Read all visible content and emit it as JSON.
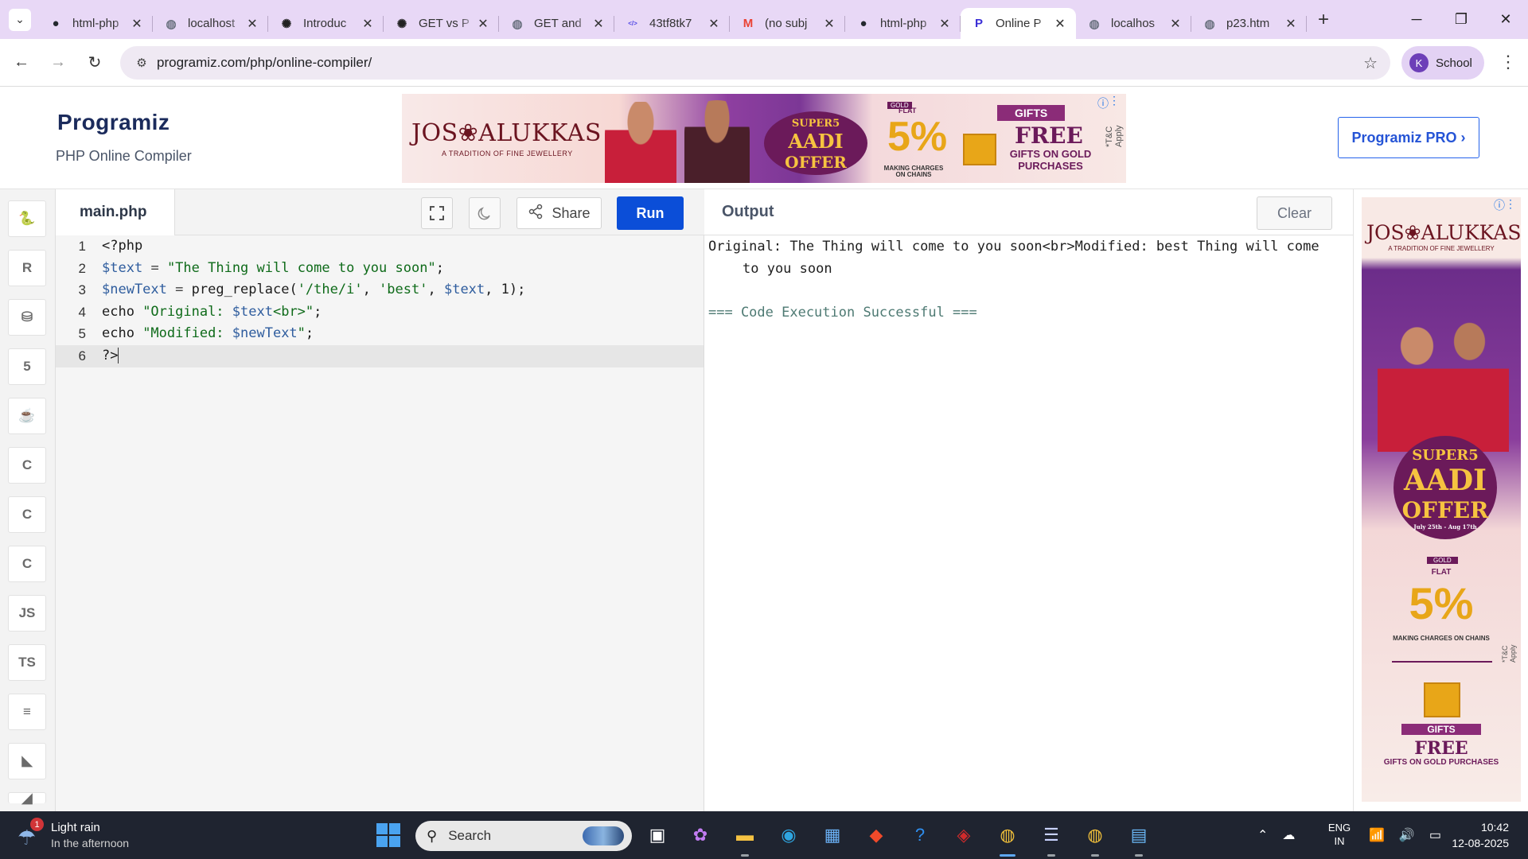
{
  "browser": {
    "tabs": [
      {
        "title": "html-php",
        "icon": "github-icon",
        "active": false
      },
      {
        "title": "localhost",
        "icon": "globe-icon",
        "active": false
      },
      {
        "title": "Introduc",
        "icon": "openai-icon",
        "active": false
      },
      {
        "title": "GET vs P",
        "icon": "openai-icon",
        "active": false
      },
      {
        "title": "GET and",
        "icon": "globe-icon",
        "active": false
      },
      {
        "title": "43tf8tk7",
        "icon": "code-icon",
        "active": false
      },
      {
        "title": "(no subj",
        "icon": "gmail-icon",
        "active": false
      },
      {
        "title": "html-php",
        "icon": "github-icon",
        "active": false
      },
      {
        "title": "Online P",
        "icon": "programiz-icon",
        "active": true
      },
      {
        "title": "localhos",
        "icon": "globe-icon",
        "active": false
      },
      {
        "title": "p23.htm",
        "icon": "globe-icon",
        "active": false
      }
    ],
    "url": "programiz.com/php/online-compiler/",
    "profile_initial": "K",
    "profile_name": "School"
  },
  "header": {
    "logo_text": "Programiz",
    "subtitle": "PHP Online Compiler",
    "pro_button": "Programiz PRO ›",
    "ad": {
      "brand": "JOS❀ALUKKAS",
      "tagline": "A TRADITION OF FINE JEWELLERY",
      "offer_line1": "SUPER5",
      "offer_line2": "AADI",
      "offer_line3": "OFFER",
      "gold": "GOLD",
      "flat": "FLAT",
      "percent": "5%",
      "making": "MAKING CHARGES ON CHAINS",
      "gifts": "GIFTS",
      "free": "FREE",
      "on_purchases": "GIFTS ON GOLD PURCHASES",
      "tc": "*T&C Apply"
    }
  },
  "editor": {
    "filename": "main.php",
    "share_label": "Share",
    "run_label": "Run",
    "lines": [
      {
        "num": "1",
        "html": "<span>&lt;?php</span>"
      },
      {
        "num": "2",
        "html": "<span class='tok-var'>$text</span> <span class='tok-op'>=</span> <span class='tok-str'>\"The Thing will come to you soon\"</span>;"
      },
      {
        "num": "3",
        "html": "<span class='tok-var'>$newText</span> <span class='tok-op'>=</span> preg_replace(<span class='tok-str'>'/the/i'</span>, <span class='tok-str'>'best'</span>, <span class='tok-var'>$text</span>, 1);"
      },
      {
        "num": "4",
        "html": "echo <span class='tok-str'>\"Original: </span><span class='tok-var'>$text</span><span class='tok-str'>&lt;br&gt;\"</span>;"
      },
      {
        "num": "5",
        "html": "echo <span class='tok-str'>\"Modified: </span><span class='tok-var'>$newText</span><span class='tok-str'>\"</span>;"
      },
      {
        "num": "6",
        "html": "?&gt;<span class='cursor'></span>"
      }
    ]
  },
  "output": {
    "title": "Output",
    "clear_label": "Clear",
    "text": "Original: The Thing will come to you soon<br>Modified: best Thing will come to you soon",
    "status": "=== Code Execution Successful ==="
  },
  "right_ad": {
    "brand": "JOS❀ALUKKAS",
    "tagline": "A TRADITION OF FINE JEWELLERY",
    "offer_line1": "SUPER5",
    "offer_line2": "AADI",
    "offer_line3": "OFFER",
    "offer_dates": "July 25th - Aug 17th",
    "gold": "GOLD",
    "flat": "FLAT",
    "percent": "5%",
    "making": "MAKING CHARGES ON CHAINS",
    "gifts": "GIFTS",
    "free": "FREE",
    "on_purchases": "GIFTS ON GOLD PURCHASES",
    "tc": "*T&C Apply"
  },
  "sidebar_langs": [
    {
      "name": "python-icon",
      "glyph": "🐍"
    },
    {
      "name": "r-icon",
      "glyph": "R"
    },
    {
      "name": "sql-icon",
      "glyph": "⛁"
    },
    {
      "name": "html-icon",
      "glyph": "5"
    },
    {
      "name": "java-icon",
      "glyph": "☕"
    },
    {
      "name": "c-icon",
      "glyph": "C"
    },
    {
      "name": "cpp-icon",
      "glyph": "C"
    },
    {
      "name": "csharp-icon",
      "glyph": "C"
    },
    {
      "name": "js-icon",
      "glyph": "JS"
    },
    {
      "name": "ts-icon",
      "glyph": "TS"
    },
    {
      "name": "go-icon",
      "glyph": "≡"
    },
    {
      "name": "swift-icon",
      "glyph": "◣"
    },
    {
      "name": "rust-icon",
      "glyph": "◢"
    }
  ],
  "taskbar": {
    "weather_line1": "Light rain",
    "weather_line2": "In the afternoon",
    "weather_badge": "1",
    "search_placeholder": "Search",
    "lang_line1": "ENG",
    "lang_line2": "IN",
    "time": "10:42",
    "date": "12-08-2025"
  }
}
